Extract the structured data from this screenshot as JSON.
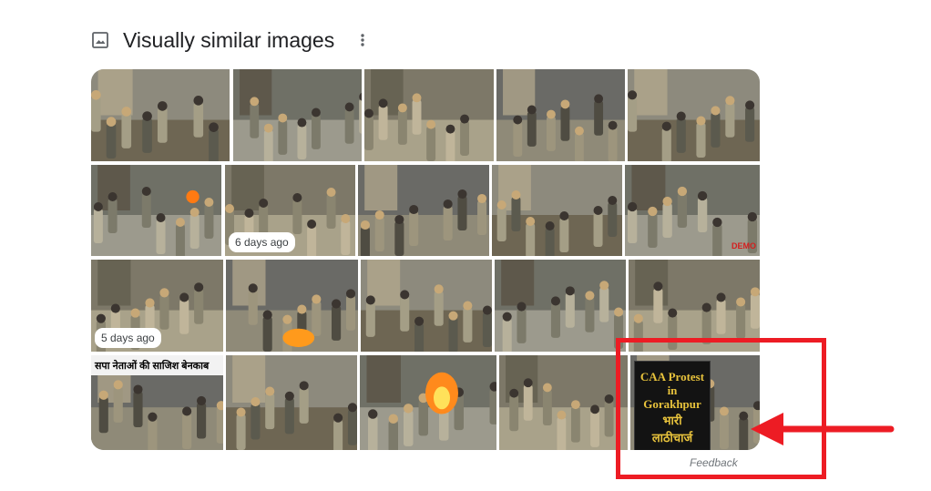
{
  "header": {
    "icon": "image-icon",
    "title": "Visually similar images",
    "more_icon": "more-vertical-icon"
  },
  "tiles": [
    {
      "row": 1,
      "col": 1
    },
    {
      "row": 1,
      "col": 2
    },
    {
      "row": 1,
      "col": 3
    },
    {
      "row": 1,
      "col": 4
    },
    {
      "row": 1,
      "col": 5
    },
    {
      "row": 2,
      "col": 1
    },
    {
      "row": 2,
      "col": 2,
      "badge": "6 days ago"
    },
    {
      "row": 2,
      "col": 3
    },
    {
      "row": 2,
      "col": 4
    },
    {
      "row": 2,
      "col": 5,
      "watermark": "DEMO"
    },
    {
      "row": 3,
      "col": 1,
      "badge": "5 days ago"
    },
    {
      "row": 3,
      "col": 2
    },
    {
      "row": 3,
      "col": 3
    },
    {
      "row": 3,
      "col": 4
    },
    {
      "row": 3,
      "col": 5
    },
    {
      "row": 4,
      "col": 1,
      "overlay_text": "सपा नेताओं की साजिश बेनकाब"
    },
    {
      "row": 4,
      "col": 2
    },
    {
      "row": 4,
      "col": 3
    },
    {
      "row": 4,
      "col": 4
    },
    {
      "row": 4,
      "col": 5,
      "poster_en": "CAA Protest\nin\nGorakhpur",
      "poster_hi_1": "भारी",
      "poster_hi_2": "लाठीचार्ज"
    }
  ],
  "feedback": "Feedback",
  "colors": {
    "annotation": "#ed1c24",
    "poster_text": "#e7c23c",
    "title_text": "#202124"
  }
}
